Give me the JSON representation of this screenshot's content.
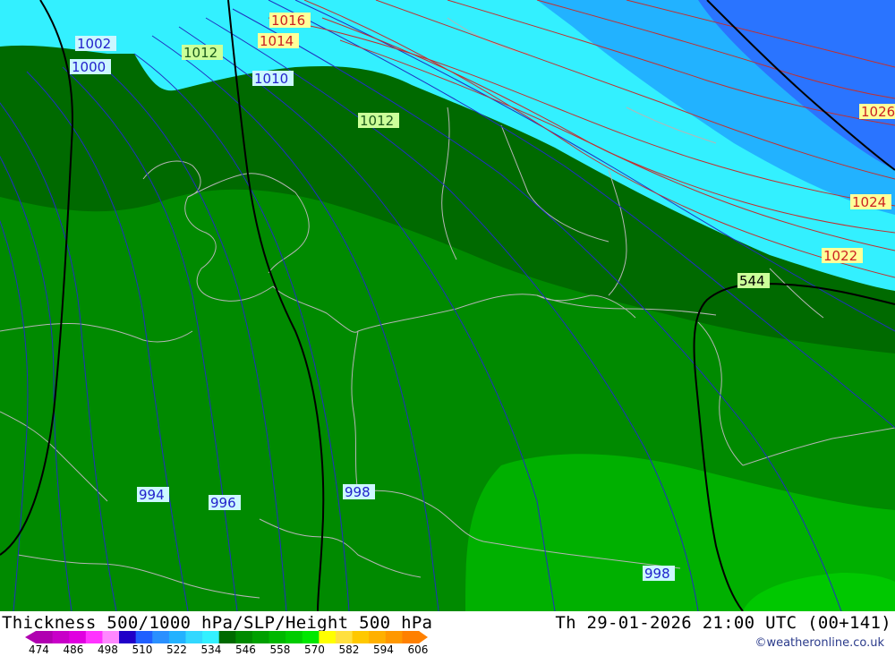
{
  "map": {
    "isobar_labels": [
      {
        "id": "1002",
        "text": "1002",
        "color": "#2222cc",
        "bg": "#ccf7ff"
      },
      {
        "id": "1000",
        "text": "1000",
        "color": "#2222cc",
        "bg": "#ccf7ff"
      },
      {
        "id": "1012a",
        "text": "1012",
        "color": "#1a5a1a",
        "bg": "#ccff99"
      },
      {
        "id": "1016",
        "text": "1016",
        "color": "#cc2222",
        "bg": "#ffff99"
      },
      {
        "id": "1014",
        "text": "1014",
        "color": "#cc2222",
        "bg": "#ffff99"
      },
      {
        "id": "1010",
        "text": "1010",
        "color": "#2222cc",
        "bg": "#ccf7ff"
      },
      {
        "id": "1012b",
        "text": "1012",
        "color": "#1a5a1a",
        "bg": "#ccff99"
      },
      {
        "id": "1026",
        "text": "1026",
        "color": "#cc2222",
        "bg": "#ffff99"
      },
      {
        "id": "1024",
        "text": "1024",
        "color": "#cc2222",
        "bg": "#ffff99"
      },
      {
        "id": "1022",
        "text": "1022",
        "color": "#cc2222",
        "bg": "#ffff99"
      },
      {
        "id": "544",
        "text": "544",
        "color": "#000000",
        "bg": "#ccff99"
      },
      {
        "id": "994",
        "text": "994",
        "color": "#2222cc",
        "bg": "#ccf7ff"
      },
      {
        "id": "996",
        "text": "996",
        "color": "#2222cc",
        "bg": "#ccf7ff"
      },
      {
        "id": "998a",
        "text": "998",
        "color": "#2222cc",
        "bg": "#ccf7ff"
      },
      {
        "id": "998b",
        "text": "998",
        "color": "#2222cc",
        "bg": "#ccf7ff"
      }
    ],
    "colors": {
      "cyan": "#33f0ff",
      "light_blue": "#22b2ff",
      "blue": "#2a74ff",
      "green_dark": "#006a00",
      "green_mid": "#008a00",
      "green_bright": "#00b000",
      "green_light": "#00c800",
      "border": "#b5b5b5",
      "isobar_low": "#2030c0",
      "isobar_high": "#c03030"
    }
  },
  "footer": {
    "title": "Thickness 500/1000 hPa/SLP/Height 500 hPa",
    "datetime": "Th 29-01-2026 21:00 UTC (00+141)",
    "credit": "©weatheronline.co.uk",
    "scale_ticks": [
      "474",
      "486",
      "498",
      "510",
      "522",
      "534",
      "546",
      "558",
      "570",
      "582",
      "594",
      "606"
    ],
    "scale_colors": [
      "#b000b0",
      "#c800c8",
      "#e000e0",
      "#ff33ff",
      "#ff88ff",
      "#2000c8",
      "#2060ff",
      "#2a90ff",
      "#22b2ff",
      "#33d8ff",
      "#33f0ff",
      "#006a00",
      "#008a00",
      "#00a000",
      "#00b800",
      "#00cc00",
      "#00e800",
      "#ffff00",
      "#ffe040",
      "#ffc800",
      "#ffb000",
      "#ff9800",
      "#ff8000"
    ]
  }
}
